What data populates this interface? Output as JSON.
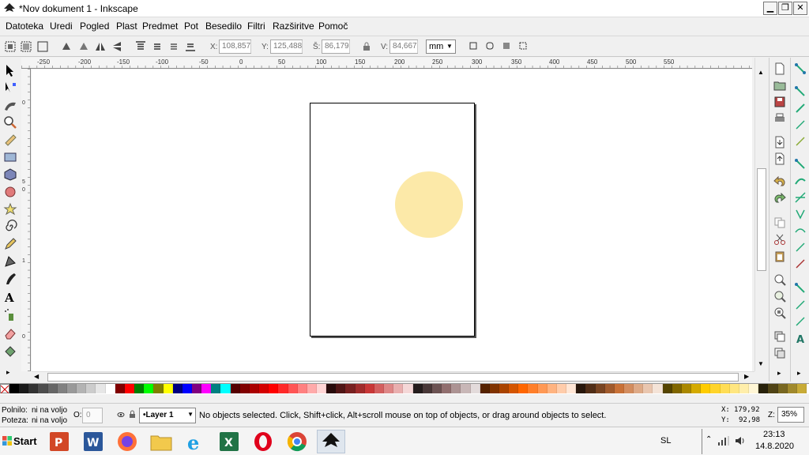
{
  "window": {
    "title": "*Nov dokument 1 - Inkscape",
    "controls": {
      "minimize": "▁",
      "maximize": "❐",
      "close": "✕"
    }
  },
  "menu": [
    "Datoteka",
    "Uredi",
    "Pogled",
    "Plast",
    "Predmet",
    "Pot",
    "Besedilo",
    "Filtri",
    "Razširitve",
    "Pomoč"
  ],
  "toolbar": {
    "x_label": "X:",
    "x_value": "108,857",
    "y_label": "Y:",
    "y_value": "125,488",
    "w_label": "Š:",
    "w_value": "86,179",
    "h_label": "V:",
    "h_value": "84,667",
    "unit": "mm"
  },
  "ruler_labels": [
    "-250",
    "-200",
    "-150",
    "-100",
    "-50",
    "0",
    "50",
    "100",
    "150",
    "200",
    "250",
    "300",
    "350",
    "400",
    "450",
    "500",
    "550"
  ],
  "vruler_labels": [
    "0",
    "5",
    "0",
    "1",
    "0"
  ],
  "canvas": {
    "circle_color": "#fce9a8"
  },
  "palette": [
    "#000000",
    "#1a1a1a",
    "#333333",
    "#4d4d4d",
    "#666666",
    "#808080",
    "#999999",
    "#b3b3b3",
    "#cccccc",
    "#e6e6e6",
    "#ffffff",
    "#800000",
    "#ff0000",
    "#008000",
    "#00ff00",
    "#808000",
    "#ffff00",
    "#000080",
    "#0000ff",
    "#800080",
    "#ff00ff",
    "#008080",
    "#00ffff",
    "#550000",
    "#800000",
    "#aa0000",
    "#d40000",
    "#ff0000",
    "#ff2a2a",
    "#ff5555",
    "#ff8080",
    "#ffaaaa",
    "#ffd5d5",
    "#280b0b",
    "#501616",
    "#782121",
    "#a02c2c",
    "#c83737",
    "#d35f5f",
    "#de8787",
    "#e9afaf",
    "#f4d7d7",
    "#241c1c",
    "#483737",
    "#6c5353",
    "#916f6f",
    "#ac9393",
    "#c8b7b7",
    "#e3dbdb",
    "#552200",
    "#803300",
    "#aa4400",
    "#d45500",
    "#ff6600",
    "#ff7f2a",
    "#ff9955",
    "#ffb380",
    "#ffccaa",
    "#ffe6d5",
    "#28170b",
    "#502d16",
    "#784421",
    "#a05a2c",
    "#c87137",
    "#d38d5f",
    "#deaa87",
    "#e9c6af",
    "#f4e3d7",
    "#554400",
    "#806600",
    "#aa8800",
    "#d4aa00",
    "#ffcc00",
    "#ffd42a",
    "#ffdd55",
    "#ffe680",
    "#ffeeaa",
    "#fff6d5",
    "#28220b",
    "#504416",
    "#786721",
    "#a0892c",
    "#c8ab37"
  ],
  "status": {
    "fill_label": "Polnilo:",
    "fill_value": "ni na voljo",
    "stroke_label": "Poteza:",
    "stroke_value": "ni na voljo",
    "opacity_label": "O:",
    "opacity_value": "0",
    "layer": "•Layer 1",
    "message": "No objects selected. Click, Shift+click, Alt+scroll mouse on top of objects, or drag around objects to select.",
    "cursor_x_label": "X:",
    "cursor_x": "179,92",
    "cursor_y_label": "Y:",
    "cursor_y": "92,98",
    "zoom_label": "Z:",
    "zoom": "35%"
  },
  "taskbar": {
    "start_label": "Start",
    "language": "SL",
    "time": "23:13",
    "date": "14.8.2020"
  }
}
